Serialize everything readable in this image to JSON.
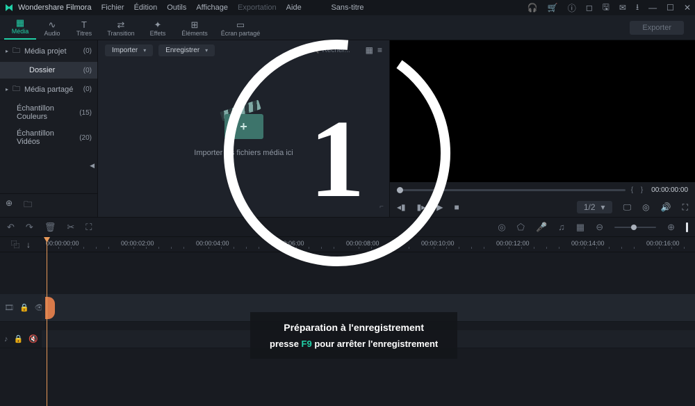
{
  "titlebar": {
    "app_name": "Wondershare Filmora",
    "menus": [
      "Fichier",
      "Édition",
      "Outils",
      "Affichage",
      "Exportation",
      "Aide"
    ],
    "menu_disabled_index": 4,
    "document_title": "Sans-titre"
  },
  "toolbar": {
    "tools": [
      {
        "icon": "▦",
        "label": "Média",
        "active": true
      },
      {
        "icon": "∿",
        "label": "Audio"
      },
      {
        "icon": "T",
        "label": "Titres"
      },
      {
        "icon": "⇄",
        "label": "Transition"
      },
      {
        "icon": "✦",
        "label": "Effets"
      },
      {
        "icon": "⊞",
        "label": "Éléments"
      },
      {
        "icon": "▭",
        "label": "Écran partagé"
      }
    ],
    "export_label": "Exporter"
  },
  "sidebar": {
    "items": [
      {
        "expander": "▸",
        "icon": "🗀",
        "name": "Média projet",
        "count": "(0)"
      },
      {
        "expander": "",
        "icon": "",
        "name": "Dossier",
        "count": "(0)",
        "selected": true,
        "indent": true
      },
      {
        "expander": "▸",
        "icon": "🗀",
        "name": "Média partagé",
        "count": "(0)"
      },
      {
        "expander": "",
        "icon": "",
        "name": "Échantillon Couleurs",
        "count": "(15)"
      },
      {
        "expander": "",
        "icon": "",
        "name": "Échantillon Vidéos",
        "count": "(20)"
      }
    ]
  },
  "media_panel": {
    "import_label": "Importer",
    "save_label": "Enregistrer",
    "search_placeholder": "Recher...",
    "drop_hint": "Importer les fichiers média ici"
  },
  "preview": {
    "timecode": "00:00:00:00",
    "zoom": "1/2"
  },
  "timeline": {
    "ticks": [
      "00:00:00:00",
      "00:00:02:00",
      "00:00:04:00",
      "00:00:06:00",
      "00:00:08:00",
      "00:00:10:00",
      "00:00:12:00",
      "00:00:14:00",
      "00:00:16:00"
    ]
  },
  "overlay": {
    "countdown": "1",
    "line1": "Préparation à l'enregistrement",
    "line2_a": "presse ",
    "line2_key": "F9",
    "line2_b": " pour arrêter l'enregistrement"
  }
}
